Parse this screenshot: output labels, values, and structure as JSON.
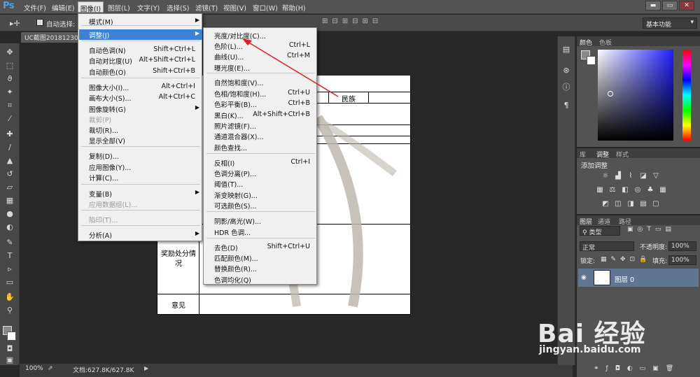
{
  "app": {
    "logo": "Ps"
  },
  "menubar": {
    "items": [
      "文件(F)",
      "编辑(E)",
      "图像(I)",
      "图层(L)",
      "文字(Y)",
      "选择(S)",
      "滤镜(T)",
      "视图(V)",
      "窗口(W)",
      "帮助(H)"
    ],
    "window_buttons": [
      "▬",
      "▭",
      "✕"
    ]
  },
  "options_bar": {
    "auto_select": "自动选择:",
    "workspace": "基本功能"
  },
  "document": {
    "tab": "UC截图20181230",
    "cells": {
      "minzu": "民族",
      "reward": "奖励处分情况",
      "opinion": "意见"
    }
  },
  "status": {
    "zoom": "100%",
    "docinfo": "文档:627.8K/627.8K"
  },
  "image_menu": {
    "items": [
      {
        "label": "模式(M)",
        "shortcut": "",
        "submenu": true,
        "disabled": false
      },
      {
        "label": "调整(J)",
        "shortcut": "",
        "submenu": true,
        "disabled": false
      },
      {
        "label": "自动色调(N)",
        "shortcut": "Shift+Ctrl+L",
        "submenu": false,
        "disabled": false
      },
      {
        "label": "自动对比度(U)",
        "shortcut": "Alt+Shift+Ctrl+L",
        "submenu": false,
        "disabled": false
      },
      {
        "label": "自动颜色(O)",
        "shortcut": "Shift+Ctrl+B",
        "submenu": false,
        "disabled": false
      },
      {
        "label": "图像大小(I)...",
        "shortcut": "Alt+Ctrl+I",
        "submenu": false,
        "disabled": false
      },
      {
        "label": "画布大小(S)...",
        "shortcut": "Alt+Ctrl+C",
        "submenu": false,
        "disabled": false
      },
      {
        "label": "图像旋转(G)",
        "shortcut": "",
        "submenu": true,
        "disabled": false
      },
      {
        "label": "裁剪(P)",
        "shortcut": "",
        "submenu": false,
        "disabled": true
      },
      {
        "label": "裁切(R)...",
        "shortcut": "",
        "submenu": false,
        "disabled": false
      },
      {
        "label": "显示全部(V)",
        "shortcut": "",
        "submenu": false,
        "disabled": false
      },
      {
        "label": "复制(D)...",
        "shortcut": "",
        "submenu": false,
        "disabled": false
      },
      {
        "label": "应用图像(Y)...",
        "shortcut": "",
        "submenu": false,
        "disabled": false
      },
      {
        "label": "计算(C)...",
        "shortcut": "",
        "submenu": false,
        "disabled": false
      },
      {
        "label": "变量(B)",
        "shortcut": "",
        "submenu": true,
        "disabled": false
      },
      {
        "label": "应用数据组(L)...",
        "shortcut": "",
        "submenu": false,
        "disabled": true
      },
      {
        "label": "陷印(T)...",
        "shortcut": "",
        "submenu": false,
        "disabled": true
      },
      {
        "label": "分析(A)",
        "shortcut": "",
        "submenu": true,
        "disabled": false
      }
    ]
  },
  "adjust_submenu": {
    "items": [
      {
        "label": "亮度/对比度(C)...",
        "shortcut": ""
      },
      {
        "label": "色阶(L)...",
        "shortcut": "Ctrl+L"
      },
      {
        "label": "曲线(U)...",
        "shortcut": "Ctrl+M"
      },
      {
        "label": "曝光度(E)...",
        "shortcut": ""
      },
      {
        "label": "自然饱和度(V)...",
        "shortcut": ""
      },
      {
        "label": "色相/饱和度(H)...",
        "shortcut": "Ctrl+U"
      },
      {
        "label": "色彩平衡(B)...",
        "shortcut": "Ctrl+B"
      },
      {
        "label": "黑白(K)...",
        "shortcut": "Alt+Shift+Ctrl+B"
      },
      {
        "label": "照片滤镜(F)...",
        "shortcut": ""
      },
      {
        "label": "通道混合器(X)...",
        "shortcut": ""
      },
      {
        "label": "颜色查找...",
        "shortcut": ""
      },
      {
        "label": "反相(I)",
        "shortcut": "Ctrl+I"
      },
      {
        "label": "色调分离(P)...",
        "shortcut": ""
      },
      {
        "label": "阈值(T)...",
        "shortcut": ""
      },
      {
        "label": "渐变映射(G)...",
        "shortcut": ""
      },
      {
        "label": "可选颜色(S)...",
        "shortcut": ""
      },
      {
        "label": "阴影/高光(W)...",
        "shortcut": ""
      },
      {
        "label": "HDR 色调...",
        "shortcut": ""
      },
      {
        "label": "去色(D)",
        "shortcut": "Shift+Ctrl+U"
      },
      {
        "label": "匹配颜色(M)...",
        "shortcut": ""
      },
      {
        "label": "替换颜色(R)...",
        "shortcut": ""
      },
      {
        "label": "色调均化(Q)",
        "shortcut": ""
      }
    ]
  },
  "panels": {
    "color": {
      "tabs": [
        "颜色",
        "色板"
      ]
    },
    "adjust": {
      "tabs": [
        "库",
        "调整",
        "样式"
      ],
      "title": "添加调整"
    },
    "layers": {
      "tabs": [
        "图层",
        "通道",
        "路径"
      ],
      "kind": "类型",
      "blend": "正常",
      "opacity_label": "不透明度:",
      "opacity": "100%",
      "lock_label": "锁定:",
      "fill_label": "填充:",
      "fill": "100%",
      "layer_name": "图层 0"
    }
  },
  "watermark": {
    "logo": "Bai 经验",
    "url": "jingyan.baidu.com"
  },
  "colors": {
    "highlight": "#3a82d6",
    "arrow": "#e02020",
    "layer_selected": "#5f7591"
  }
}
